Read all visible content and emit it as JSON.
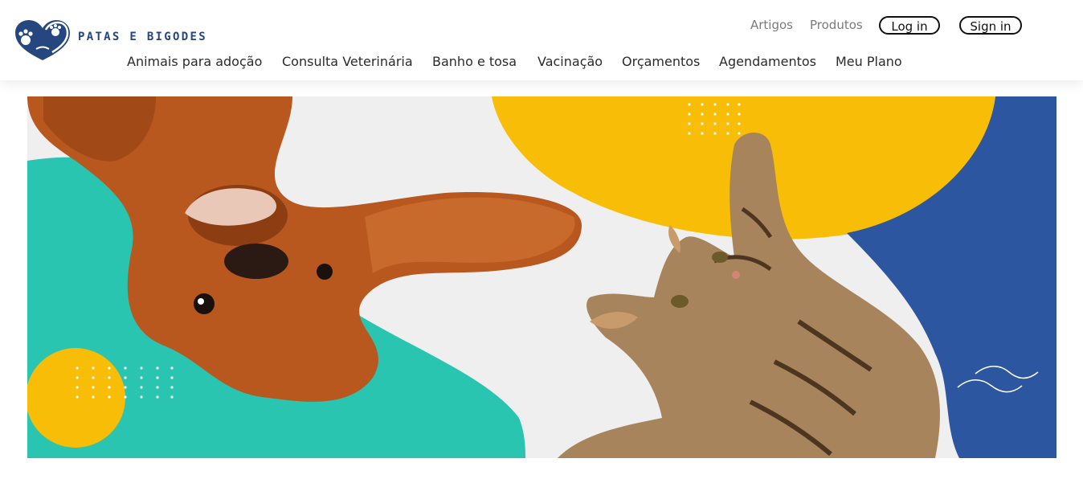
{
  "brand": {
    "name": "PATAS E BIGODES",
    "accent_color": "#26467f",
    "logo_icon": "paw-heart-logo-icon"
  },
  "top_links": {
    "articles": "Artigos",
    "products": "Produtos"
  },
  "auth": {
    "login_label": "Log in",
    "signin_label": "Sign in"
  },
  "nav": {
    "items": [
      {
        "label": "Animais para adoção"
      },
      {
        "label": "Consulta Veterinária"
      },
      {
        "label": "Banho e tosa"
      },
      {
        "label": "Vacinação"
      },
      {
        "label": "Orçamentos"
      },
      {
        "label": "Agendamentos"
      },
      {
        "label": "Meu Plano"
      }
    ]
  },
  "hero": {
    "image": "dog-and-cat-banner",
    "colors": {
      "teal": "#2ac5b0",
      "yellow": "#f7bd07",
      "blue": "#2c57a0",
      "background": "#efefef"
    }
  }
}
